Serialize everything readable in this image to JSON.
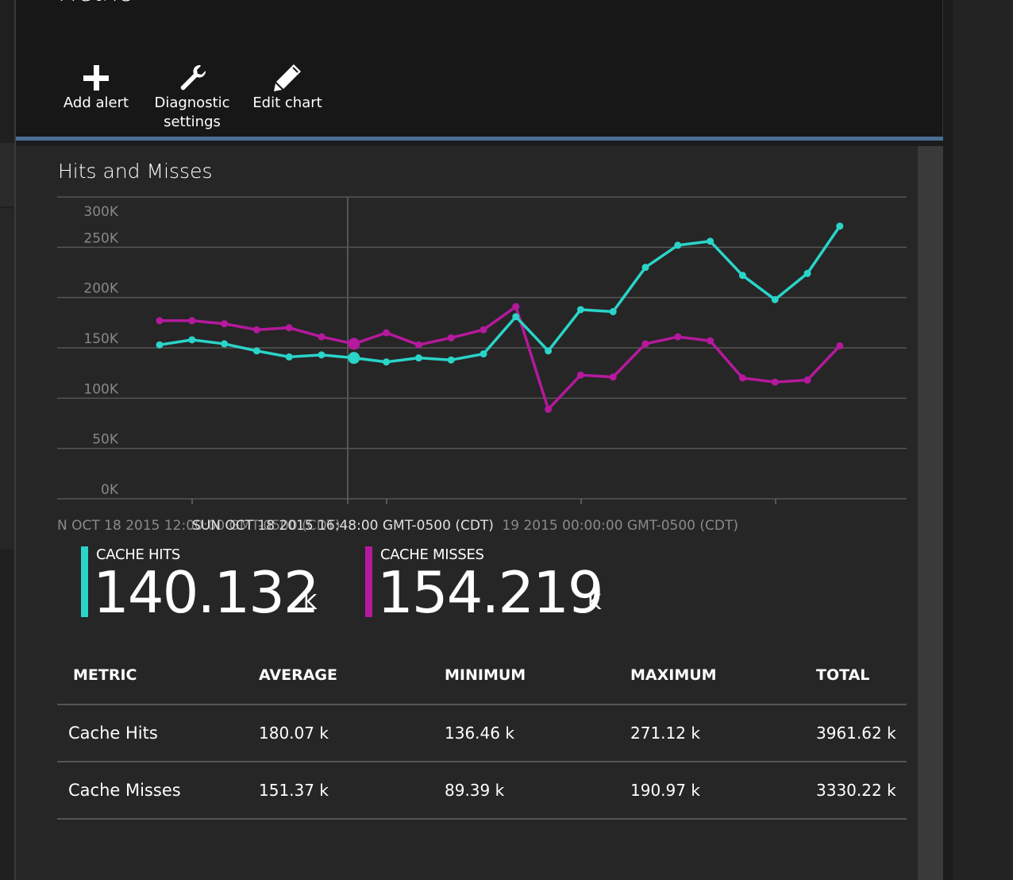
{
  "blade": {
    "title": "Metric"
  },
  "toolbar": {
    "add_alert": "Add alert",
    "diagnostic_line1": "Diagnostic",
    "diagnostic_line2": "settings",
    "edit_chart": "Edit chart"
  },
  "chart_title": "Hits and Misses",
  "chart_data": {
    "type": "line",
    "title": "Hits and Misses",
    "ylim": [
      0,
      300000
    ],
    "y_ticks": [
      "300K",
      "250K",
      "200K",
      "150K",
      "100K",
      "50K",
      "0K"
    ],
    "grid": true,
    "x_label_left": "N OCT 18 2015 12:00:00 GMT-0500 (CDT)",
    "x_label_hover": "SUN OCT 18 2015 16:48:00 GMT-0500 (CDT)",
    "x_label_right": "19 2015 00:00:00 GMT-0500 (CDT)",
    "hover_index": 6,
    "series": [
      {
        "name": "CACHE HITS",
        "color": "#2ad4c9",
        "values": [
          153000,
          158000,
          154000,
          147000,
          141000,
          143000,
          140000,
          136000,
          140000,
          138000,
          144000,
          181000,
          147000,
          188000,
          186000,
          230000,
          252000,
          256000,
          222000,
          198000,
          224000,
          271000
        ]
      },
      {
        "name": "CACHE MISSES",
        "color": "#b5199d",
        "values": [
          177000,
          177000,
          174000,
          168000,
          170000,
          161000,
          154000,
          165000,
          153000,
          160000,
          168000,
          191000,
          89000,
          123000,
          121000,
          154000,
          161000,
          157000,
          120000,
          116000,
          118000,
          152000
        ]
      }
    ]
  },
  "summary": {
    "hits": {
      "label": "CACHE HITS",
      "value": "140.132",
      "unit": "K",
      "color": "#2ad4c9"
    },
    "misses": {
      "label": "CACHE MISSES",
      "value": "154.219",
      "unit": "K",
      "color": "#b5199d"
    }
  },
  "table": {
    "headers": [
      "METRIC",
      "AVERAGE",
      "MINIMUM",
      "MAXIMUM",
      "TOTAL"
    ],
    "rows": [
      [
        "Cache Hits",
        "180.07 k",
        "136.46 k",
        "271.12 k",
        "3961.62 k"
      ],
      [
        "Cache Misses",
        "151.37 k",
        "89.39 k",
        "190.97 k",
        "3330.22 k"
      ]
    ]
  }
}
